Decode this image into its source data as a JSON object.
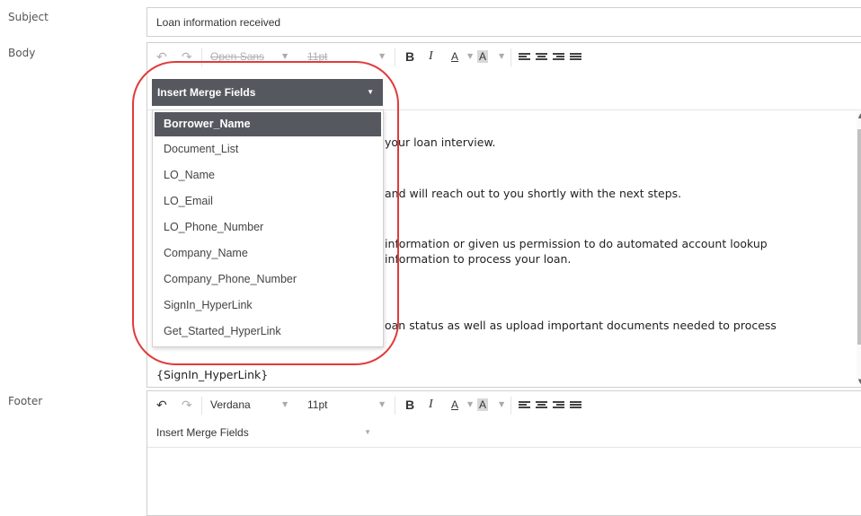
{
  "labels": {
    "subject": "Subject",
    "body": "Body",
    "footer": "Footer"
  },
  "subject": {
    "value": "Loan information received"
  },
  "body_editor": {
    "toolbar": {
      "font": "Open Sans",
      "size": "11pt",
      "bold": "B",
      "italic": "I",
      "font_color": "A",
      "highlight": "A"
    },
    "merge_fields_label": "Insert Merge Fields",
    "merge_fields_options": [
      "Borrower_Name",
      "Document_List",
      "LO_Name",
      "LO_Email",
      "LO_Phone_Number",
      "Company_Name",
      "Company_Phone_Number",
      "SignIn_HyperLink",
      "Get_Started_HyperLink"
    ],
    "selected_option": "Borrower_Name",
    "content_lines": [
      "your loan interview.",
      "and will reach out to you shortly with the next steps.",
      "information or given us permission to do automated account lookup",
      "information to process your loan.",
      "oan status as well as upload important documents needed to process",
      "{SignIn_HyperLink}"
    ]
  },
  "footer_editor": {
    "toolbar": {
      "font": "Verdana",
      "size": "11pt",
      "bold": "B",
      "italic": "I",
      "font_color": "A",
      "highlight": "A"
    },
    "merge_fields_label": "Insert Merge Fields"
  },
  "colors": {
    "highlight_ring": "#e23a3a",
    "dropdown_header": "#55595f"
  }
}
